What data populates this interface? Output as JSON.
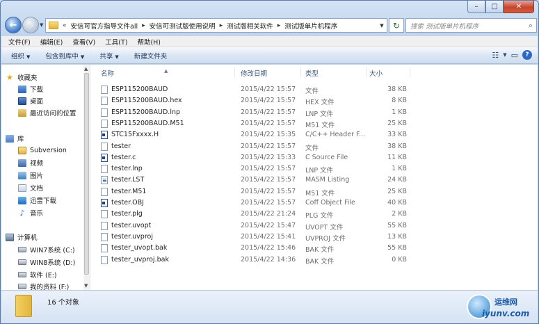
{
  "window": {
    "min_label": "–",
    "max_label": "□",
    "close_label": "✕"
  },
  "address": {
    "prefix": "«",
    "crumbs": [
      "安信可官方指导文件all",
      "安信可测试版使用说明",
      "测试版相关软件",
      "测试版单片机程序"
    ],
    "separator": "▸"
  },
  "search": {
    "placeholder": "搜索 测试版单片机程序"
  },
  "menu": [
    "文件(F)",
    "编辑(E)",
    "查看(V)",
    "工具(T)",
    "帮助(H)"
  ],
  "toolbar": {
    "organize": "组织",
    "include_library": "包含到库中",
    "share": "共享",
    "new_folder": "新建文件夹"
  },
  "nav": {
    "favorites": "收藏夹",
    "downloads": "下载",
    "desktop": "桌面",
    "recent": "最近访问的位置",
    "libraries": "库",
    "subversion": "Subversion",
    "videos": "视频",
    "pictures": "图片",
    "documents": "文档",
    "thunder": "迅雷下载",
    "music": "音乐",
    "computer": "计算机",
    "drive_c": "WIN7系统 (C:)",
    "drive_d": "WIN8系统 (D:)",
    "drive_e": "软件 (E:)",
    "drive_f": "我的资料 (F:)"
  },
  "columns": {
    "name": "名称",
    "date": "修改日期",
    "type": "类型",
    "size": "大小"
  },
  "files": [
    {
      "name": "ESP115200BAUD",
      "date": "2015/4/22 15:57",
      "type": "文件",
      "size": "38 KB",
      "icon": "blank"
    },
    {
      "name": "ESP115200BAUD.hex",
      "date": "2015/4/22 15:57",
      "type": "HEX 文件",
      "size": "8 KB",
      "icon": "blank"
    },
    {
      "name": "ESP115200BAUD.lnp",
      "date": "2015/4/22 15:57",
      "type": "LNP 文件",
      "size": "1 KB",
      "icon": "blank"
    },
    {
      "name": "ESP115200BAUD.M51",
      "date": "2015/4/22 15:57",
      "type": "M51 文件",
      "size": "25 KB",
      "icon": "blank"
    },
    {
      "name": "STC15Fxxxx.H",
      "date": "2015/4/22 15:35",
      "type": "C/C++ Header F...",
      "size": "33 KB",
      "icon": "code"
    },
    {
      "name": "tester",
      "date": "2015/4/22 15:57",
      "type": "文件",
      "size": "38 KB",
      "icon": "blank"
    },
    {
      "name": "tester.c",
      "date": "2015/4/22 15:33",
      "type": "C Source File",
      "size": "11 KB",
      "icon": "code"
    },
    {
      "name": "tester.lnp",
      "date": "2015/4/22 15:57",
      "type": "LNP 文件",
      "size": "1 KB",
      "icon": "blank"
    },
    {
      "name": "tester.LST",
      "date": "2015/4/22 15:57",
      "type": "MASM Listing",
      "size": "24 KB",
      "icon": "lst"
    },
    {
      "name": "tester.M51",
      "date": "2015/4/22 15:57",
      "type": "M51 文件",
      "size": "25 KB",
      "icon": "blank"
    },
    {
      "name": "tester.OBJ",
      "date": "2015/4/22 15:57",
      "type": "Coff Object File",
      "size": "40 KB",
      "icon": "code"
    },
    {
      "name": "tester.plg",
      "date": "2015/4/22 21:24",
      "type": "PLG 文件",
      "size": "2 KB",
      "icon": "blank"
    },
    {
      "name": "tester.uvopt",
      "date": "2015/4/22 15:47",
      "type": "UVOPT 文件",
      "size": "55 KB",
      "icon": "blank"
    },
    {
      "name": "tester.uvproj",
      "date": "2015/4/22 15:41",
      "type": "UVPROJ 文件",
      "size": "13 KB",
      "icon": "blank"
    },
    {
      "name": "tester_uvopt.bak",
      "date": "2015/4/22 15:46",
      "type": "BAK 文件",
      "size": "55 KB",
      "icon": "blank"
    },
    {
      "name": "tester_uvproj.bak",
      "date": "2015/4/22 14:36",
      "type": "BAK 文件",
      "size": "0 KB",
      "icon": "blank"
    }
  ],
  "status": {
    "count": "16 个对象"
  },
  "watermark": {
    "line1": "运维网",
    "line2": "iyunv.com"
  }
}
